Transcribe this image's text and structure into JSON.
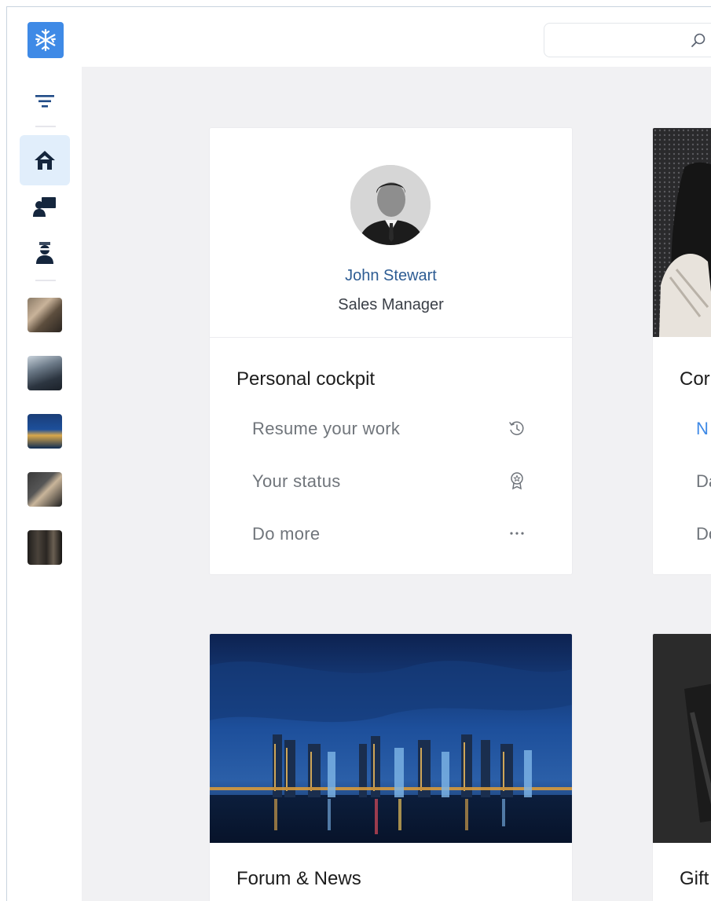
{
  "search": {
    "placeholder": "",
    "value": ""
  },
  "sidebar": {
    "logo_icon": "snowflake-logo",
    "menu_icon": "filter-menu-icon",
    "nav": [
      {
        "id": "home",
        "icon": "home-icon",
        "active": true
      },
      {
        "id": "presentation",
        "icon": "presenter-icon",
        "active": false
      },
      {
        "id": "support",
        "icon": "agent-icon",
        "active": false
      }
    ],
    "shortcuts": [
      "workspace-thumbnail",
      "buildings-thumbnail",
      "city-night-thumbnail",
      "gift-thumbnail",
      "library-thumbnail"
    ]
  },
  "profile": {
    "name": "John Stewart",
    "role": "Sales Manager"
  },
  "cockpit": {
    "title": "Personal cockpit",
    "items": [
      {
        "label": "Resume your work",
        "icon": "history-icon"
      },
      {
        "label": "Your status",
        "icon": "award-icon"
      },
      {
        "label": "Do more",
        "icon": "more-icon"
      }
    ]
  },
  "company_card": {
    "title_partial": "Cor",
    "items_partial": [
      {
        "text": "N",
        "highlight": true
      },
      {
        "text": "Da",
        "highlight": false
      },
      {
        "text": "Do",
        "highlight": false
      }
    ]
  },
  "forum_card": {
    "title": "Forum & News"
  },
  "gift_card": {
    "title_partial": "Gift"
  },
  "colors": {
    "accent": "#3f8ae6",
    "name_link": "#2d5c93",
    "active_nav_bg": "#e1eefb",
    "highlight_text": "#3f8ae6",
    "background": "#f1f1f3"
  }
}
